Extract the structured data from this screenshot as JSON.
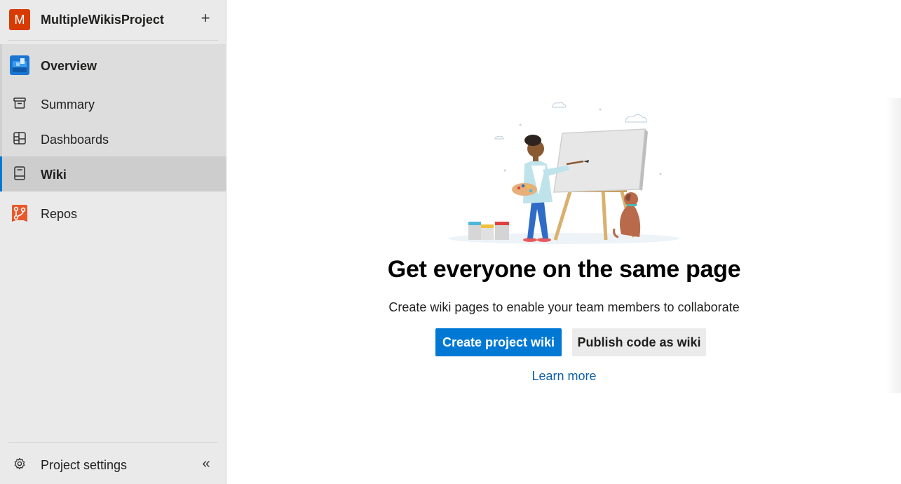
{
  "project": {
    "avatar_letter": "M",
    "name": "MultipleWikisProject",
    "add_icon": "plus-icon",
    "accent": "#d83b01"
  },
  "nav": {
    "overview": "Overview",
    "summary": "Summary",
    "dashboards": "Dashboards",
    "wiki": "Wiki",
    "repos": "Repos",
    "selected": "Wiki",
    "selected_accent": "#0078d4"
  },
  "footer": {
    "settings": "Project settings",
    "settings_icon": "gear-icon",
    "collapse_icon": "double-chevron-left-icon"
  },
  "main": {
    "title": "Get everyone on the same page",
    "subtitle": "Create wiki pages to enable your team members to collaborate",
    "primary_button": "Create project wiki",
    "secondary_button": "Publish code as wiki",
    "link": "Learn more",
    "primary_color": "#0078d4"
  }
}
